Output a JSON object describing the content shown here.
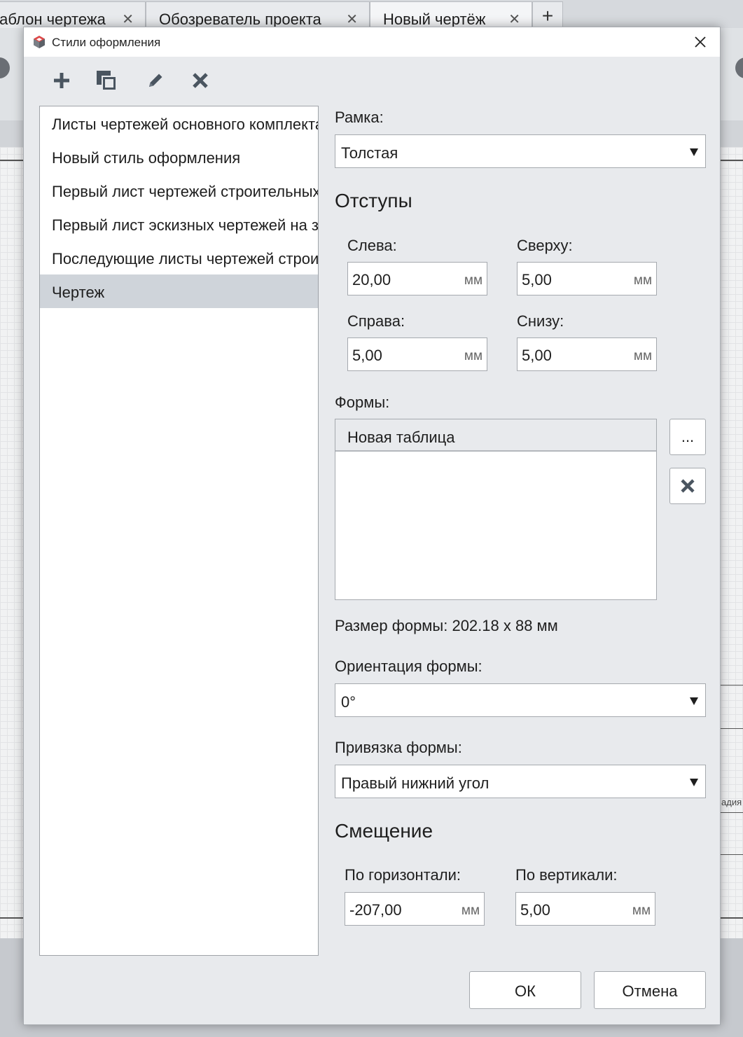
{
  "tabs": [
    {
      "label": "Шаблон чертежа"
    },
    {
      "label": "Обозреватель проекта"
    },
    {
      "label": "Новый чертёж"
    }
  ],
  "background_fragment": "адия",
  "dialog": {
    "title": "Стили оформления",
    "styles": [
      "Листы чертежей основного комплекта",
      "Новый стиль оформления",
      "Первый лист чертежей строительных изделий",
      "Первый лист эскизных чертежей на заказ",
      "Последующие листы чертежей строительных изделий",
      "Чертеж"
    ],
    "selected_style": "Чертеж",
    "frame": {
      "label": "Рамка:",
      "value": "Толстая"
    },
    "margins": {
      "title": "Отступы",
      "left": {
        "label": "Слева:",
        "value": "20,00",
        "unit": "мм"
      },
      "top": {
        "label": "Сверху:",
        "value": "5,00",
        "unit": "мм"
      },
      "right": {
        "label": "Справа:",
        "value": "5,00",
        "unit": "мм"
      },
      "bottom": {
        "label": "Снизу:",
        "value": "5,00",
        "unit": "мм"
      }
    },
    "forms": {
      "label": "Формы:",
      "items": [
        "Новая таблица"
      ],
      "browse_label": "..."
    },
    "form_size": "Размер формы: 202.18 x 88 мм",
    "orientation": {
      "label": "Ориентация формы:",
      "value": "0°"
    },
    "anchor": {
      "label": "Привязка формы:",
      "value": "Правый нижний угол"
    },
    "offset": {
      "title": "Смещение",
      "horizontal": {
        "label": "По горизонтали:",
        "value": "-207,00",
        "unit": "мм"
      },
      "vertical": {
        "label": "По вертикали:",
        "value": "5,00",
        "unit": "мм"
      }
    },
    "ok_label": "ОК",
    "cancel_label": "Отмена"
  },
  "colors": {
    "selection": "#cfd4da",
    "dialog_bg": "#e8eaed",
    "icon": "#4a5560"
  }
}
